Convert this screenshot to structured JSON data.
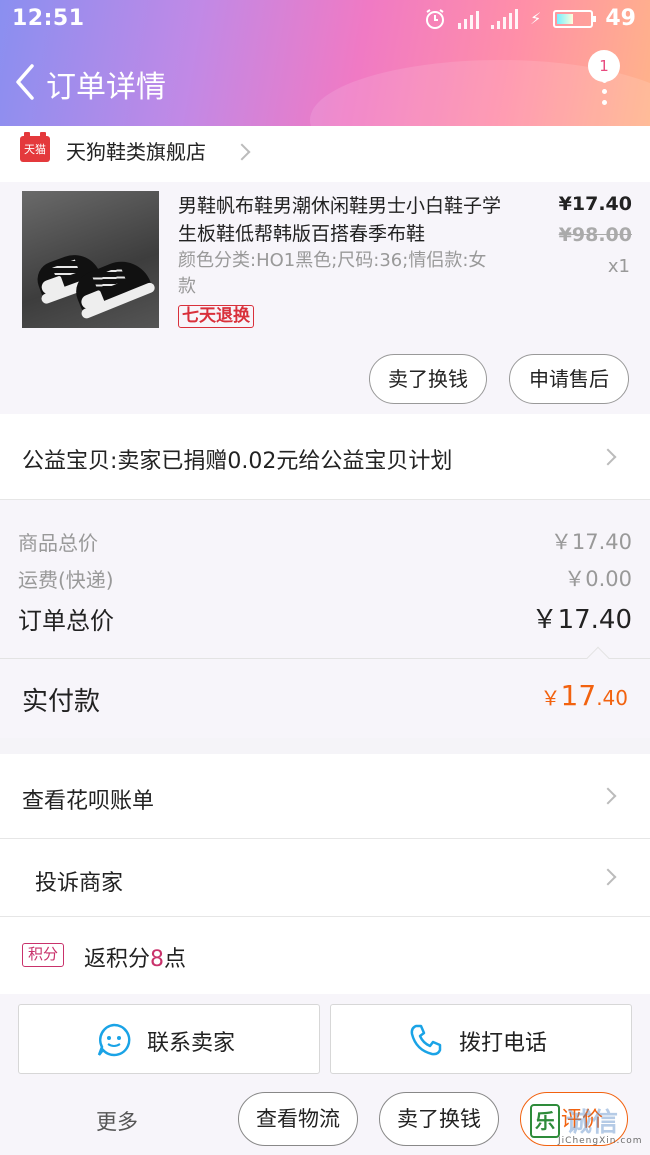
{
  "status_bar": {
    "time": "12:51",
    "battery": "49"
  },
  "navbar": {
    "title": "订单详情",
    "badge_count": "1"
  },
  "store": {
    "logo_text": "天猫",
    "name": "天狗鞋类旗舰店"
  },
  "product": {
    "title": "男鞋帆布鞋男潮休闲鞋男士小白鞋子学生板鞋低帮韩版百搭春季布鞋",
    "spec": "颜色分类:HO1黑色;尺码:36;情侣款:女款",
    "price": "¥17.40",
    "original_price": "¥98.00",
    "quantity": "x1",
    "return_tag": "七天退换",
    "actions": [
      "卖了换钱",
      "申请售后"
    ]
  },
  "charity": {
    "text": "公益宝贝:卖家已捐赠0.02元给公益宝贝计划"
  },
  "summary": {
    "items": [
      {
        "label": "商品总价",
        "value": "￥17.40"
      },
      {
        "label": "运费(快递)",
        "value": "￥0.00"
      }
    ],
    "total_label": "订单总价",
    "total_value": "￥17.40"
  },
  "paid": {
    "label": "实付款",
    "currency": "￥",
    "integer": "17",
    "decimal": ".40"
  },
  "links": {
    "huabei": "查看花呗账单",
    "complain": "投诉商家"
  },
  "points": {
    "tag": "积分",
    "prefix": "返积分",
    "amount": "8",
    "suffix": "点"
  },
  "bottom": {
    "contact_seller": "联系卖家",
    "call_phone": "拨打电话",
    "more": "更多",
    "logistics": "查看物流",
    "sell": "卖了换钱",
    "review": "评价"
  },
  "watermark": {
    "icon": "乐",
    "text": "诚信",
    "sub": "JiChengXin.com"
  },
  "colors": {
    "accent_orange": "#f2620f",
    "tmall_red": "#e4393c",
    "tag_red": "#d9303b",
    "points_pink": "#c9326b",
    "icon_blue": "#1aa3e6"
  }
}
